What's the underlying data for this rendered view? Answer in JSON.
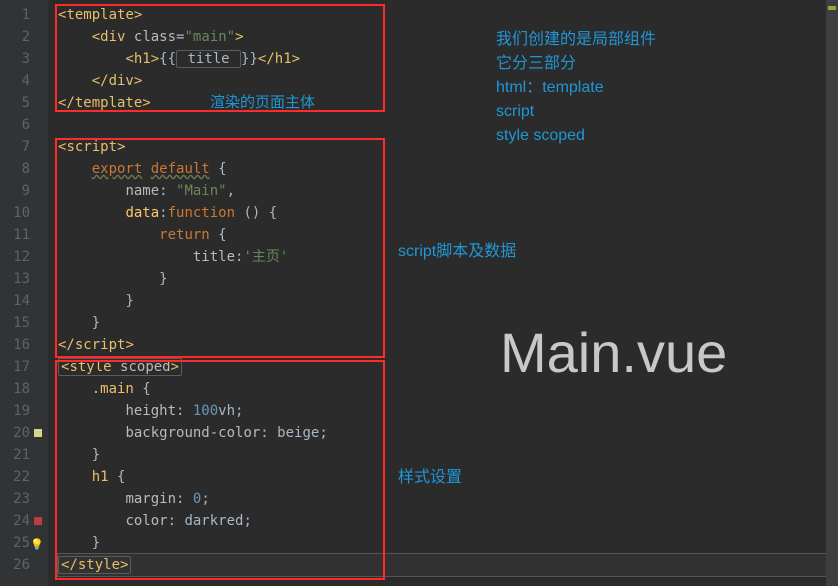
{
  "lines": [
    {
      "n": "1"
    },
    {
      "n": "2"
    },
    {
      "n": "3"
    },
    {
      "n": "4"
    },
    {
      "n": "5"
    },
    {
      "n": "6"
    },
    {
      "n": "7"
    },
    {
      "n": "8"
    },
    {
      "n": "9"
    },
    {
      "n": "10"
    },
    {
      "n": "11"
    },
    {
      "n": "12"
    },
    {
      "n": "13"
    },
    {
      "n": "14"
    },
    {
      "n": "15"
    },
    {
      "n": "16"
    },
    {
      "n": "17"
    },
    {
      "n": "18"
    },
    {
      "n": "19"
    },
    {
      "n": "20"
    },
    {
      "n": "21"
    },
    {
      "n": "22"
    },
    {
      "n": "23"
    },
    {
      "n": "24"
    },
    {
      "n": "25"
    },
    {
      "n": "26"
    }
  ],
  "code": {
    "l1": {
      "open": "<",
      "tag": "template",
      "close": ">"
    },
    "l2": {
      "open": "<",
      "tag": "div",
      "sp": " ",
      "attr": "class",
      "eq": "=",
      "q": "\"",
      "val": "main",
      "close": ">"
    },
    "l3": {
      "open": "<",
      "tag": "h1",
      "close": ">",
      "lb": "{{",
      "title": " title ",
      "rb": "}}",
      "copen": "</",
      "ctag": "h1",
      "cclose": ">"
    },
    "l4": {
      "open": "</",
      "tag": "div",
      "close": ">"
    },
    "l5": {
      "open": "</",
      "tag": "template",
      "close": ">"
    },
    "l7": {
      "open": "<",
      "tag": "script",
      "close": ">"
    },
    "l8": {
      "kw1": "export",
      "sp": " ",
      "kw2": "default",
      "b": " {"
    },
    "l9": {
      "attr": "name",
      "col": ": ",
      "q": "\"",
      "val": "Main",
      "c": ","
    },
    "l10": {
      "attr": "data",
      "col": ":",
      "kw": "function",
      "p": " () {"
    },
    "l11": {
      "kw": "return",
      "b": " {"
    },
    "l12": {
      "attr": "title",
      "col": ":",
      "q": "'",
      "val": "主页"
    },
    "l13": {
      "b": "}"
    },
    "l14": {
      "b": "}"
    },
    "l15": {
      "b": "}"
    },
    "l16": {
      "open": "</",
      "tag": "script",
      "close": ">"
    },
    "l17": {
      "open": "<",
      "tag": "style",
      "sp": " ",
      "attr": "scoped",
      "close": ">"
    },
    "l18": {
      "sel": ".main",
      "b": " {"
    },
    "l19": {
      "prop": "height",
      "col": ": ",
      "num": "100",
      "unit": "vh",
      "sc": ";"
    },
    "l20": {
      "prop": "background-color",
      "col": ": ",
      "val": "beige",
      "sc": ";"
    },
    "l21": {
      "b": "}"
    },
    "l22": {
      "sel": "h1",
      "b": " {"
    },
    "l23": {
      "prop": "margin",
      "col": ": ",
      "num": "0",
      "sc": ";"
    },
    "l24": {
      "prop": "color",
      "col": ": ",
      "val": "darkred",
      "sc": ";"
    },
    "l25": {
      "b": "}"
    },
    "l26": {
      "open": "</",
      "tag": "style",
      "close": ">"
    }
  },
  "annotations": {
    "right_block": "我们创建的是局部组件\n它分三部分\nhtml：template\nscript\nstyle scoped",
    "inline_template": "渲染的页面主体",
    "script_label": "script脚本及数据",
    "style_label": "样式设置",
    "filename": "Main.vue"
  }
}
